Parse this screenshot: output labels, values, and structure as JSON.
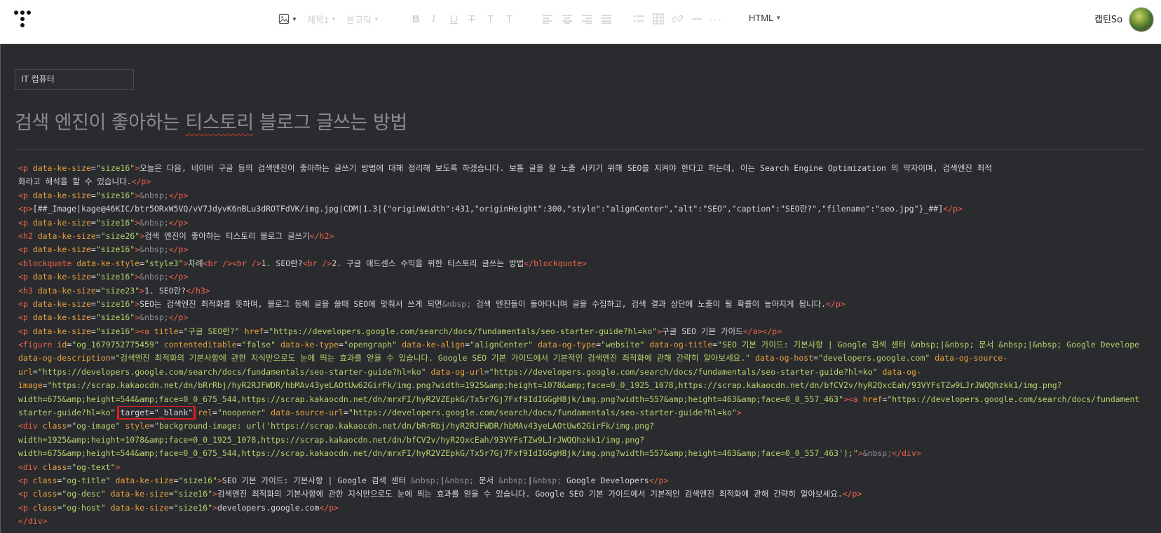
{
  "toolbar": {
    "format_label": "제목1",
    "font_label": "본고딕",
    "mode_label": "HTML",
    "user_name": "캡틴So"
  },
  "editor": {
    "category": "IT 컴퓨터",
    "title_before": "검색 엔진이 좋아하는 ",
    "title_spell": "티스토리",
    "title_after": " 블로그 글쓰는 방법"
  },
  "code_lines": [
    [
      [
        "t",
        "<p "
      ],
      [
        "a",
        "data-ke-size"
      ],
      [
        "x",
        "="
      ],
      [
        "v",
        "\"size16\""
      ],
      [
        "t",
        ">"
      ],
      [
        "x",
        "오늘은 다음, 네이버 구글 등의 검색엔진이 좋아하는 글쓰기 방법에 대해 정리해 보도록 하겠습니다. 보통 글을 잘 노출 시키기 위해 SEO를 지켜야 한다고 하는데, 이는 Search Engine Optimization 의 약자이며, 검색엔진 최적"
      ]
    ],
    [
      [
        "x",
        "화라고 해석을 할 수 있습니다."
      ],
      [
        "t",
        "</p>"
      ]
    ],
    [
      [
        "t",
        "<p "
      ],
      [
        "a",
        "data-ke-size"
      ],
      [
        "x",
        "="
      ],
      [
        "v",
        "\"size16\""
      ],
      [
        "t",
        ">"
      ],
      [
        "e",
        "&nbsp;"
      ],
      [
        "t",
        "</p>"
      ]
    ],
    [
      [
        "t",
        "<p>"
      ],
      [
        "x",
        "[##_Image|kage@46KIC/btr5ORxW5VQ/vV7JdyvK6nBLu3dROTFdVK/img.jpg|CDM|1.3|{\"originWidth\":431,\"originHeight\":300,\"style\":\"alignCenter\",\"alt\":\"SEO\",\"caption\":\"SEO란?\",\"filename\":\"seo.jpg\"}_##]"
      ],
      [
        "t",
        "</p>"
      ]
    ],
    [
      [
        "t",
        "<p "
      ],
      [
        "a",
        "data-ke-size"
      ],
      [
        "x",
        "="
      ],
      [
        "v",
        "\"size16\""
      ],
      [
        "t",
        ">"
      ],
      [
        "e",
        "&nbsp;"
      ],
      [
        "t",
        "</p>"
      ]
    ],
    [
      [
        "t",
        "<h2 "
      ],
      [
        "a",
        "data-ke-size"
      ],
      [
        "x",
        "="
      ],
      [
        "v",
        "\"size26\""
      ],
      [
        "t",
        ">"
      ],
      [
        "x",
        "검색 엔진이 좋아하는 티스토리 블로그 글쓰기"
      ],
      [
        "t",
        "</h2>"
      ]
    ],
    [
      [
        "t",
        "<p "
      ],
      [
        "a",
        "data-ke-size"
      ],
      [
        "x",
        "="
      ],
      [
        "v",
        "\"size16\""
      ],
      [
        "t",
        ">"
      ],
      [
        "e",
        "&nbsp;"
      ],
      [
        "t",
        "</p>"
      ]
    ],
    [
      [
        "t",
        "<blockquote "
      ],
      [
        "a",
        "data-ke-style"
      ],
      [
        "x",
        "="
      ],
      [
        "v",
        "\"style3\""
      ],
      [
        "t",
        ">"
      ],
      [
        "x",
        "차례"
      ],
      [
        "t",
        "<br />"
      ],
      [
        "t",
        "<br />"
      ],
      [
        "x",
        "1. SEO란?"
      ],
      [
        "t",
        "<br />"
      ],
      [
        "x",
        "2. 구글 애드센스 수익을 위한 티스토리 글쓰는 방법"
      ],
      [
        "t",
        "</blockquote>"
      ]
    ],
    [
      [
        "t",
        "<p "
      ],
      [
        "a",
        "data-ke-size"
      ],
      [
        "x",
        "="
      ],
      [
        "v",
        "\"size16\""
      ],
      [
        "t",
        ">"
      ],
      [
        "e",
        "&nbsp;"
      ],
      [
        "t",
        "</p>"
      ]
    ],
    [
      [
        "t",
        "<h3 "
      ],
      [
        "a",
        "data-ke-size"
      ],
      [
        "x",
        "="
      ],
      [
        "v",
        "\"size23\""
      ],
      [
        "t",
        ">"
      ],
      [
        "x",
        "1. SEO란?"
      ],
      [
        "t",
        "</h3>"
      ]
    ],
    [
      [
        "t",
        "<p "
      ],
      [
        "a",
        "data-ke-size"
      ],
      [
        "x",
        "="
      ],
      [
        "v",
        "\"size16\""
      ],
      [
        "t",
        ">"
      ],
      [
        "x",
        "SEO는 검색엔진 최적화를 뜻하며, 블로그 등에 글을 쓸때 SEO에 맞춰서 쓰게 되면"
      ],
      [
        "e",
        "&nbsp;"
      ],
      [
        "x",
        " 검색 엔진들이 돌아다니며 글을 수집하고, 검색 결과 상단에 노출이 될 확률이 높아지게 됩니다."
      ],
      [
        "t",
        "</p>"
      ]
    ],
    [
      [
        "t",
        "<p "
      ],
      [
        "a",
        "data-ke-size"
      ],
      [
        "x",
        "="
      ],
      [
        "v",
        "\"size16\""
      ],
      [
        "t",
        ">"
      ],
      [
        "e",
        "&nbsp;"
      ],
      [
        "t",
        "</p>"
      ]
    ],
    [
      [
        "t",
        "<p "
      ],
      [
        "a",
        "data-ke-size"
      ],
      [
        "x",
        "="
      ],
      [
        "v",
        "\"size16\""
      ],
      [
        "t",
        ">"
      ],
      [
        "t",
        "<a "
      ],
      [
        "a",
        "title"
      ],
      [
        "x",
        "="
      ],
      [
        "v",
        "\"구글 SEO란?\""
      ],
      [
        "x",
        " "
      ],
      [
        "a",
        "href"
      ],
      [
        "x",
        "="
      ],
      [
        "v",
        "\"https://developers.google.com/search/docs/fundamentals/seo-starter-guide?hl=ko\""
      ],
      [
        "t",
        ">"
      ],
      [
        "x",
        "구글 SEO 기본 가이드"
      ],
      [
        "t",
        "</a>"
      ],
      [
        "t",
        "</p>"
      ]
    ],
    [
      [
        "t",
        "<figure "
      ],
      [
        "a",
        "id"
      ],
      [
        "x",
        "="
      ],
      [
        "v",
        "\"og_1679752775459\""
      ],
      [
        "x",
        " "
      ],
      [
        "a",
        "contenteditable"
      ],
      [
        "x",
        "="
      ],
      [
        "v",
        "\"false\""
      ],
      [
        "x",
        " "
      ],
      [
        "a",
        "data-ke-type"
      ],
      [
        "x",
        "="
      ],
      [
        "v",
        "\"opengraph\""
      ],
      [
        "x",
        " "
      ],
      [
        "a",
        "data-ke-align"
      ],
      [
        "x",
        "="
      ],
      [
        "v",
        "\"alignCenter\""
      ],
      [
        "x",
        " "
      ],
      [
        "a",
        "data-og-type"
      ],
      [
        "x",
        "="
      ],
      [
        "v",
        "\"website\""
      ],
      [
        "x",
        " "
      ],
      [
        "a",
        "data-og-title"
      ],
      [
        "x",
        "="
      ],
      [
        "v",
        "\"SEO 기본 가이드: 기본사항 | Google 검색 센터 &nbsp;|&nbsp; 문서 &nbsp;|&nbsp; Google Developers\""
      ]
    ],
    [
      [
        "a",
        "data-og-description"
      ],
      [
        "x",
        "="
      ],
      [
        "v",
        "\"검색엔진 최적화의 기본사항에 관한 지식만으로도 눈에 띄는 효과를 얻을 수 있습니다. Google SEO 기본 가이드에서 기본적인 검색엔진 최적화에 관해 간략히 알아보세요.\""
      ],
      [
        "x",
        " "
      ],
      [
        "a",
        "data-og-host"
      ],
      [
        "x",
        "="
      ],
      [
        "v",
        "\"developers.google.com\""
      ],
      [
        "x",
        " "
      ],
      [
        "a",
        "data-og-source-"
      ]
    ],
    [
      [
        "a",
        "url"
      ],
      [
        "x",
        "="
      ],
      [
        "v",
        "\"https://developers.google.com/search/docs/fundamentals/seo-starter-guide?hl=ko\""
      ],
      [
        "x",
        " "
      ],
      [
        "a",
        "data-og-url"
      ],
      [
        "x",
        "="
      ],
      [
        "v",
        "\"https://developers.google.com/search/docs/fundamentals/seo-starter-guide?hl=ko\""
      ],
      [
        "x",
        " "
      ],
      [
        "a",
        "data-og-"
      ]
    ],
    [
      [
        "a",
        "image"
      ],
      [
        "x",
        "="
      ],
      [
        "v",
        "\"https://scrap.kakaocdn.net/dn/bRrRbj/hyR2RJFWDR/hbMAv43yeLAOtUw62GirFk/img.png?width=1925&amp;height=1078&amp;face=0_0_1925_1078,https://scrap.kakaocdn.net/dn/bfCV2v/hyR2QxcEah/93VYFsTZw9LJrJWQQhzkk1/img.png?"
      ]
    ],
    [
      [
        "v",
        "width=675&amp;height=544&amp;face=0_0_675_544,https://scrap.kakaocdn.net/dn/mrxFI/hyR2VZEpkG/Tx5r7Gj7Fxf9IdIGGgH8jk/img.png?width=557&amp;height=463&amp;face=0_0_557_463\""
      ],
      [
        "t",
        ">"
      ],
      [
        "t",
        "<a "
      ],
      [
        "a",
        "href"
      ],
      [
        "x",
        "="
      ],
      [
        "v",
        "\"https://developers.google.com/search/docs/fundamentals/seo-"
      ]
    ],
    [
      [
        "v",
        "starter-guide?hl=ko\""
      ],
      [
        "x",
        " "
      ],
      [
        "hl",
        "target=\"_blank\""
      ],
      [
        "x",
        " "
      ],
      [
        "a",
        "rel"
      ],
      [
        "x",
        "="
      ],
      [
        "v",
        "\"noopener\""
      ],
      [
        "x",
        " "
      ],
      [
        "a",
        "data-source-url"
      ],
      [
        "x",
        "="
      ],
      [
        "v",
        "\"https://developers.google.com/search/docs/fundamentals/seo-starter-guide?hl=ko\""
      ],
      [
        "t",
        ">"
      ]
    ],
    [
      [
        "t",
        "<div "
      ],
      [
        "a",
        "class"
      ],
      [
        "x",
        "="
      ],
      [
        "v",
        "\"og-image\""
      ],
      [
        "x",
        " "
      ],
      [
        "a",
        "style"
      ],
      [
        "x",
        "="
      ],
      [
        "v",
        "\"background-image: url('https://scrap.kakaocdn.net/dn/bRrRbj/hyR2RJFWDR/hbMAv43yeLAOtUw62GirFk/img.png?"
      ]
    ],
    [
      [
        "v",
        "width=1925&amp;height=1078&amp;face=0_0_1925_1078,https://scrap.kakaocdn.net/dn/bfCV2v/hyR2QxcEah/93VYFsTZw9LJrJWQQhzkk1/img.png?"
      ]
    ],
    [
      [
        "v",
        "width=675&amp;height=544&amp;face=0_0_675_544,https://scrap.kakaocdn.net/dn/mrxFI/hyR2VZEpkG/Tx5r7Gj7Fxf9IdIGGgH8jk/img.png?width=557&amp;height=463&amp;face=0_0_557_463');\""
      ],
      [
        "t",
        ">"
      ],
      [
        "e",
        "&nbsp;"
      ],
      [
        "t",
        "</div>"
      ]
    ],
    [
      [
        "t",
        "<div "
      ],
      [
        "a",
        "class"
      ],
      [
        "x",
        "="
      ],
      [
        "v",
        "\"og-text\""
      ],
      [
        "t",
        ">"
      ]
    ],
    [
      [
        "t",
        "<p "
      ],
      [
        "a",
        "class"
      ],
      [
        "x",
        "="
      ],
      [
        "v",
        "\"og-title\""
      ],
      [
        "x",
        " "
      ],
      [
        "a",
        "data-ke-size"
      ],
      [
        "x",
        "="
      ],
      [
        "v",
        "\"size16\""
      ],
      [
        "t",
        ">"
      ],
      [
        "x",
        "SEO 기본 가이드: 기본사항 | Google 검색 센터 "
      ],
      [
        "e",
        "&nbsp;"
      ],
      [
        "x",
        "|"
      ],
      [
        "e",
        "&nbsp;"
      ],
      [
        "x",
        " 문서 "
      ],
      [
        "e",
        "&nbsp;"
      ],
      [
        "x",
        "|"
      ],
      [
        "e",
        "&nbsp;"
      ],
      [
        "x",
        " Google Developers"
      ],
      [
        "t",
        "</p>"
      ]
    ],
    [
      [
        "t",
        "<p "
      ],
      [
        "a",
        "class"
      ],
      [
        "x",
        "="
      ],
      [
        "v",
        "\"og-desc\""
      ],
      [
        "x",
        " "
      ],
      [
        "a",
        "data-ke-size"
      ],
      [
        "x",
        "="
      ],
      [
        "v",
        "\"size16\""
      ],
      [
        "t",
        ">"
      ],
      [
        "x",
        "검색엔진 최적화의 기본사항에 관한 지식만으로도 눈에 띄는 효과를 얻을 수 있습니다. Google SEO 기본 가이드에서 기본적인 검색엔진 최적화에 관해 간략히 알아보세요."
      ],
      [
        "t",
        "</p>"
      ]
    ],
    [
      [
        "t",
        "<p "
      ],
      [
        "a",
        "class"
      ],
      [
        "x",
        "="
      ],
      [
        "v",
        "\"og-host\""
      ],
      [
        "x",
        " "
      ],
      [
        "a",
        "data-ke-size"
      ],
      [
        "x",
        "="
      ],
      [
        "v",
        "\"size16\""
      ],
      [
        "t",
        ">"
      ],
      [
        "x",
        "developers.google.com"
      ],
      [
        "t",
        "</p>"
      ]
    ],
    [
      [
        "t",
        "</div>"
      ]
    ]
  ],
  "colors": {
    "editor_bg": "#292b2f",
    "tag": "#f0624a",
    "attr": "#e9a23b",
    "value": "#b5d36b",
    "highlight": "#e11d1d"
  },
  "icons": [
    "tistory-logo-icon",
    "image-icon",
    "bold-icon",
    "italic-icon",
    "underline-icon",
    "strikethrough-icon",
    "text-color-icon",
    "highlight-icon",
    "align-left-icon",
    "align-center-icon",
    "align-right-icon",
    "align-justify-icon",
    "list-icon",
    "table-icon",
    "link-icon",
    "horizontal-rule-icon",
    "more-icon",
    "chevron-down-icon"
  ]
}
